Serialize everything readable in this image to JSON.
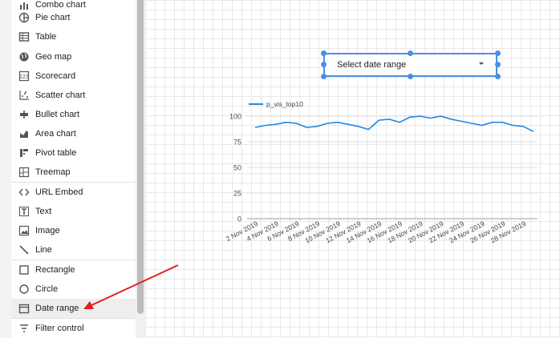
{
  "menu": {
    "items": [
      {
        "label": "Combo chart",
        "icon": "combo-chart-icon"
      },
      {
        "label": "Pie chart",
        "icon": "pie-chart-icon"
      },
      {
        "label": "Table",
        "icon": "table-icon"
      },
      {
        "label": "Geo map",
        "icon": "globe-icon"
      },
      {
        "label": "Scorecard",
        "icon": "scorecard-icon"
      },
      {
        "label": "Scatter chart",
        "icon": "scatter-chart-icon"
      },
      {
        "label": "Bullet chart",
        "icon": "bullet-chart-icon"
      },
      {
        "label": "Area chart",
        "icon": "area-chart-icon"
      },
      {
        "label": "Pivot table",
        "icon": "pivot-table-icon"
      },
      {
        "label": "Treemap",
        "icon": "treemap-icon"
      },
      {
        "label": "URL Embed",
        "icon": "code-icon"
      },
      {
        "label": "Text",
        "icon": "text-icon"
      },
      {
        "label": "Image",
        "icon": "image-icon"
      },
      {
        "label": "Line",
        "icon": "line-icon"
      },
      {
        "label": "Rectangle",
        "icon": "rectangle-icon"
      },
      {
        "label": "Circle",
        "icon": "circle-icon"
      },
      {
        "label": "Date range",
        "icon": "calendar-icon"
      },
      {
        "label": "Filter control",
        "icon": "filter-icon"
      }
    ],
    "active_item": "Date range"
  },
  "date_range_control": {
    "label": "Select date range",
    "icon": "dropdown-arrow-icon",
    "selected": true
  },
  "chart_data": {
    "type": "line",
    "legend": "p_vis_top10",
    "legend_position": "top-left",
    "grid": true,
    "ylim": [
      0,
      100
    ],
    "y_ticks": [
      "0",
      "25",
      "50",
      "75",
      "100"
    ],
    "x_tick_labels": [
      "2 Nov 2019",
      "4 Nov 2019",
      "6 Nov 2019",
      "8 Nov 2019",
      "10 Nov 2019",
      "12 Nov 2019",
      "14 Nov 2019",
      "16 Nov 2019",
      "18 Nov 2019",
      "20 Nov 2019",
      "22 Nov 2019",
      "24 Nov 2019",
      "26 Nov 2019",
      "28 Nov 2019"
    ],
    "series": [
      {
        "name": "p_vis_top10",
        "color": "#1e88e5",
        "values": [
          89,
          91,
          92,
          94,
          93,
          89,
          90,
          93,
          94,
          92,
          90,
          87,
          96,
          97,
          94,
          99,
          100,
          98,
          100,
          97,
          95,
          93,
          91,
          94,
          94,
          91,
          90,
          85
        ]
      }
    ]
  },
  "annotation": {
    "color": "#e02020",
    "icon": "red-arrow-annotation"
  }
}
